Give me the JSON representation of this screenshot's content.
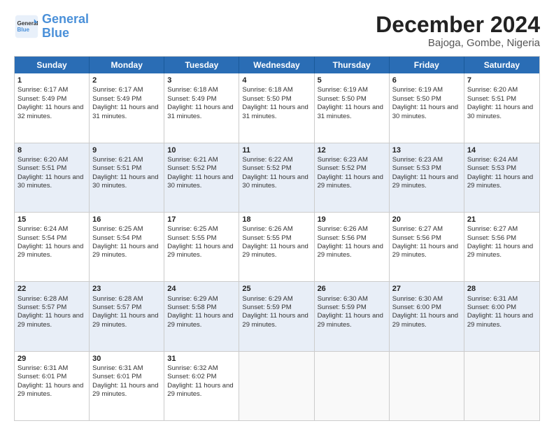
{
  "logo": {
    "line1": "General",
    "line2": "Blue"
  },
  "title": "December 2024",
  "subtitle": "Bajoga, Gombe, Nigeria",
  "header_days": [
    "Sunday",
    "Monday",
    "Tuesday",
    "Wednesday",
    "Thursday",
    "Friday",
    "Saturday"
  ],
  "rows": [
    [
      {
        "day": "1",
        "text": "Sunrise: 6:17 AM\nSunset: 5:49 PM\nDaylight: 11 hours and 32 minutes."
      },
      {
        "day": "2",
        "text": "Sunrise: 6:17 AM\nSunset: 5:49 PM\nDaylight: 11 hours and 31 minutes."
      },
      {
        "day": "3",
        "text": "Sunrise: 6:18 AM\nSunset: 5:49 PM\nDaylight: 11 hours and 31 minutes."
      },
      {
        "day": "4",
        "text": "Sunrise: 6:18 AM\nSunset: 5:50 PM\nDaylight: 11 hours and 31 minutes."
      },
      {
        "day": "5",
        "text": "Sunrise: 6:19 AM\nSunset: 5:50 PM\nDaylight: 11 hours and 31 minutes."
      },
      {
        "day": "6",
        "text": "Sunrise: 6:19 AM\nSunset: 5:50 PM\nDaylight: 11 hours and 30 minutes."
      },
      {
        "day": "7",
        "text": "Sunrise: 6:20 AM\nSunset: 5:51 PM\nDaylight: 11 hours and 30 minutes."
      }
    ],
    [
      {
        "day": "8",
        "text": "Sunrise: 6:20 AM\nSunset: 5:51 PM\nDaylight: 11 hours and 30 minutes."
      },
      {
        "day": "9",
        "text": "Sunrise: 6:21 AM\nSunset: 5:51 PM\nDaylight: 11 hours and 30 minutes."
      },
      {
        "day": "10",
        "text": "Sunrise: 6:21 AM\nSunset: 5:52 PM\nDaylight: 11 hours and 30 minutes."
      },
      {
        "day": "11",
        "text": "Sunrise: 6:22 AM\nSunset: 5:52 PM\nDaylight: 11 hours and 30 minutes."
      },
      {
        "day": "12",
        "text": "Sunrise: 6:23 AM\nSunset: 5:52 PM\nDaylight: 11 hours and 29 minutes."
      },
      {
        "day": "13",
        "text": "Sunrise: 6:23 AM\nSunset: 5:53 PM\nDaylight: 11 hours and 29 minutes."
      },
      {
        "day": "14",
        "text": "Sunrise: 6:24 AM\nSunset: 5:53 PM\nDaylight: 11 hours and 29 minutes."
      }
    ],
    [
      {
        "day": "15",
        "text": "Sunrise: 6:24 AM\nSunset: 5:54 PM\nDaylight: 11 hours and 29 minutes."
      },
      {
        "day": "16",
        "text": "Sunrise: 6:25 AM\nSunset: 5:54 PM\nDaylight: 11 hours and 29 minutes."
      },
      {
        "day": "17",
        "text": "Sunrise: 6:25 AM\nSunset: 5:55 PM\nDaylight: 11 hours and 29 minutes."
      },
      {
        "day": "18",
        "text": "Sunrise: 6:26 AM\nSunset: 5:55 PM\nDaylight: 11 hours and 29 minutes."
      },
      {
        "day": "19",
        "text": "Sunrise: 6:26 AM\nSunset: 5:56 PM\nDaylight: 11 hours and 29 minutes."
      },
      {
        "day": "20",
        "text": "Sunrise: 6:27 AM\nSunset: 5:56 PM\nDaylight: 11 hours and 29 minutes."
      },
      {
        "day": "21",
        "text": "Sunrise: 6:27 AM\nSunset: 5:56 PM\nDaylight: 11 hours and 29 minutes."
      }
    ],
    [
      {
        "day": "22",
        "text": "Sunrise: 6:28 AM\nSunset: 5:57 PM\nDaylight: 11 hours and 29 minutes."
      },
      {
        "day": "23",
        "text": "Sunrise: 6:28 AM\nSunset: 5:57 PM\nDaylight: 11 hours and 29 minutes."
      },
      {
        "day": "24",
        "text": "Sunrise: 6:29 AM\nSunset: 5:58 PM\nDaylight: 11 hours and 29 minutes."
      },
      {
        "day": "25",
        "text": "Sunrise: 6:29 AM\nSunset: 5:59 PM\nDaylight: 11 hours and 29 minutes."
      },
      {
        "day": "26",
        "text": "Sunrise: 6:30 AM\nSunset: 5:59 PM\nDaylight: 11 hours and 29 minutes."
      },
      {
        "day": "27",
        "text": "Sunrise: 6:30 AM\nSunset: 6:00 PM\nDaylight: 11 hours and 29 minutes."
      },
      {
        "day": "28",
        "text": "Sunrise: 6:31 AM\nSunset: 6:00 PM\nDaylight: 11 hours and 29 minutes."
      }
    ],
    [
      {
        "day": "29",
        "text": "Sunrise: 6:31 AM\nSunset: 6:01 PM\nDaylight: 11 hours and 29 minutes."
      },
      {
        "day": "30",
        "text": "Sunrise: 6:31 AM\nSunset: 6:01 PM\nDaylight: 11 hours and 29 minutes."
      },
      {
        "day": "31",
        "text": "Sunrise: 6:32 AM\nSunset: 6:02 PM\nDaylight: 11 hours and 29 minutes."
      },
      {
        "day": "",
        "text": ""
      },
      {
        "day": "",
        "text": ""
      },
      {
        "day": "",
        "text": ""
      },
      {
        "day": "",
        "text": ""
      }
    ]
  ]
}
